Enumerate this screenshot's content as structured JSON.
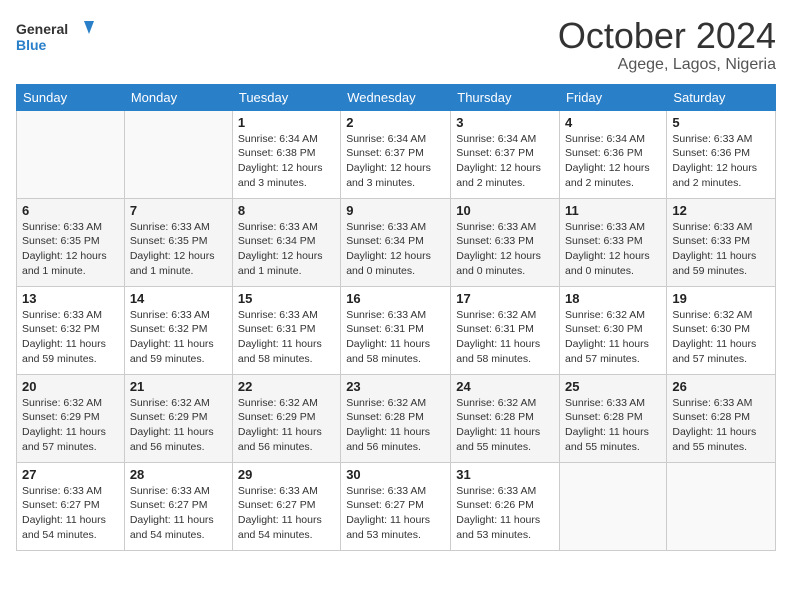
{
  "header": {
    "logo_line1": "General",
    "logo_line2": "Blue",
    "month": "October 2024",
    "location": "Agege, Lagos, Nigeria"
  },
  "weekdays": [
    "Sunday",
    "Monday",
    "Tuesday",
    "Wednesday",
    "Thursday",
    "Friday",
    "Saturday"
  ],
  "weeks": [
    [
      {
        "day": "",
        "info": ""
      },
      {
        "day": "",
        "info": ""
      },
      {
        "day": "1",
        "info": "Sunrise: 6:34 AM\nSunset: 6:38 PM\nDaylight: 12 hours and 3 minutes."
      },
      {
        "day": "2",
        "info": "Sunrise: 6:34 AM\nSunset: 6:37 PM\nDaylight: 12 hours and 3 minutes."
      },
      {
        "day": "3",
        "info": "Sunrise: 6:34 AM\nSunset: 6:37 PM\nDaylight: 12 hours and 2 minutes."
      },
      {
        "day": "4",
        "info": "Sunrise: 6:34 AM\nSunset: 6:36 PM\nDaylight: 12 hours and 2 minutes."
      },
      {
        "day": "5",
        "info": "Sunrise: 6:33 AM\nSunset: 6:36 PM\nDaylight: 12 hours and 2 minutes."
      }
    ],
    [
      {
        "day": "6",
        "info": "Sunrise: 6:33 AM\nSunset: 6:35 PM\nDaylight: 12 hours and 1 minute."
      },
      {
        "day": "7",
        "info": "Sunrise: 6:33 AM\nSunset: 6:35 PM\nDaylight: 12 hours and 1 minute."
      },
      {
        "day": "8",
        "info": "Sunrise: 6:33 AM\nSunset: 6:34 PM\nDaylight: 12 hours and 1 minute."
      },
      {
        "day": "9",
        "info": "Sunrise: 6:33 AM\nSunset: 6:34 PM\nDaylight: 12 hours and 0 minutes."
      },
      {
        "day": "10",
        "info": "Sunrise: 6:33 AM\nSunset: 6:33 PM\nDaylight: 12 hours and 0 minutes."
      },
      {
        "day": "11",
        "info": "Sunrise: 6:33 AM\nSunset: 6:33 PM\nDaylight: 12 hours and 0 minutes."
      },
      {
        "day": "12",
        "info": "Sunrise: 6:33 AM\nSunset: 6:33 PM\nDaylight: 11 hours and 59 minutes."
      }
    ],
    [
      {
        "day": "13",
        "info": "Sunrise: 6:33 AM\nSunset: 6:32 PM\nDaylight: 11 hours and 59 minutes."
      },
      {
        "day": "14",
        "info": "Sunrise: 6:33 AM\nSunset: 6:32 PM\nDaylight: 11 hours and 59 minutes."
      },
      {
        "day": "15",
        "info": "Sunrise: 6:33 AM\nSunset: 6:31 PM\nDaylight: 11 hours and 58 minutes."
      },
      {
        "day": "16",
        "info": "Sunrise: 6:33 AM\nSunset: 6:31 PM\nDaylight: 11 hours and 58 minutes."
      },
      {
        "day": "17",
        "info": "Sunrise: 6:32 AM\nSunset: 6:31 PM\nDaylight: 11 hours and 58 minutes."
      },
      {
        "day": "18",
        "info": "Sunrise: 6:32 AM\nSunset: 6:30 PM\nDaylight: 11 hours and 57 minutes."
      },
      {
        "day": "19",
        "info": "Sunrise: 6:32 AM\nSunset: 6:30 PM\nDaylight: 11 hours and 57 minutes."
      }
    ],
    [
      {
        "day": "20",
        "info": "Sunrise: 6:32 AM\nSunset: 6:29 PM\nDaylight: 11 hours and 57 minutes."
      },
      {
        "day": "21",
        "info": "Sunrise: 6:32 AM\nSunset: 6:29 PM\nDaylight: 11 hours and 56 minutes."
      },
      {
        "day": "22",
        "info": "Sunrise: 6:32 AM\nSunset: 6:29 PM\nDaylight: 11 hours and 56 minutes."
      },
      {
        "day": "23",
        "info": "Sunrise: 6:32 AM\nSunset: 6:28 PM\nDaylight: 11 hours and 56 minutes."
      },
      {
        "day": "24",
        "info": "Sunrise: 6:32 AM\nSunset: 6:28 PM\nDaylight: 11 hours and 55 minutes."
      },
      {
        "day": "25",
        "info": "Sunrise: 6:33 AM\nSunset: 6:28 PM\nDaylight: 11 hours and 55 minutes."
      },
      {
        "day": "26",
        "info": "Sunrise: 6:33 AM\nSunset: 6:28 PM\nDaylight: 11 hours and 55 minutes."
      }
    ],
    [
      {
        "day": "27",
        "info": "Sunrise: 6:33 AM\nSunset: 6:27 PM\nDaylight: 11 hours and 54 minutes."
      },
      {
        "day": "28",
        "info": "Sunrise: 6:33 AM\nSunset: 6:27 PM\nDaylight: 11 hours and 54 minutes."
      },
      {
        "day": "29",
        "info": "Sunrise: 6:33 AM\nSunset: 6:27 PM\nDaylight: 11 hours and 54 minutes."
      },
      {
        "day": "30",
        "info": "Sunrise: 6:33 AM\nSunset: 6:27 PM\nDaylight: 11 hours and 53 minutes."
      },
      {
        "day": "31",
        "info": "Sunrise: 6:33 AM\nSunset: 6:26 PM\nDaylight: 11 hours and 53 minutes."
      },
      {
        "day": "",
        "info": ""
      },
      {
        "day": "",
        "info": ""
      }
    ]
  ]
}
